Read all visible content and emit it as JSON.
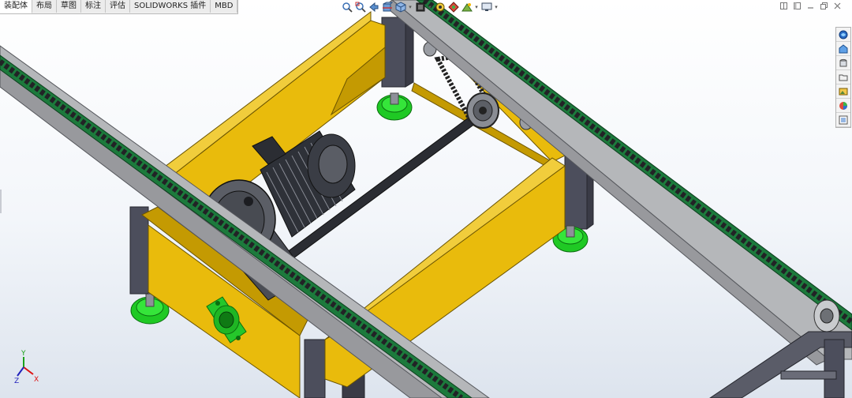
{
  "tabs": [
    {
      "label": "装配体",
      "active": true
    },
    {
      "label": "布局",
      "active": false
    },
    {
      "label": "草图",
      "active": false
    },
    {
      "label": "标注",
      "active": false
    },
    {
      "label": "评估",
      "active": false
    },
    {
      "label": "SOLIDWORKS 插件",
      "active": false
    },
    {
      "label": "MBD",
      "active": false
    }
  ],
  "view_toolbar": [
    "zoom-to-fit-icon",
    "zoom-to-area-icon",
    "previous-view-icon",
    "section-view-icon",
    "view-orientation-icon",
    "display-style-icon",
    "hide-show-items-icon",
    "edit-appearance-icon",
    "apply-scene-icon",
    "view-settings-icon"
  ],
  "task_pane": [
    "solidworks-resources-icon",
    "design-library-icon",
    "file-explorer-icon",
    "view-palette-icon",
    "appearances-scenes-icon",
    "custom-properties-icon"
  ],
  "triad_axes": {
    "x": "X",
    "y": "Y",
    "z": "Z"
  },
  "colors": {
    "frame_yellow": "#e9bb0c",
    "frame_yellow_dark": "#c49a02",
    "leg_gray": "#4c4e5c",
    "rail_gray": "#b5b7ba",
    "chain": "#222326",
    "chain_green": "#1c7a3c",
    "foot_green": "#1fc924",
    "motor": "#2e3138",
    "background_top": "#ffffff",
    "background_bottom": "#dde4ee"
  }
}
